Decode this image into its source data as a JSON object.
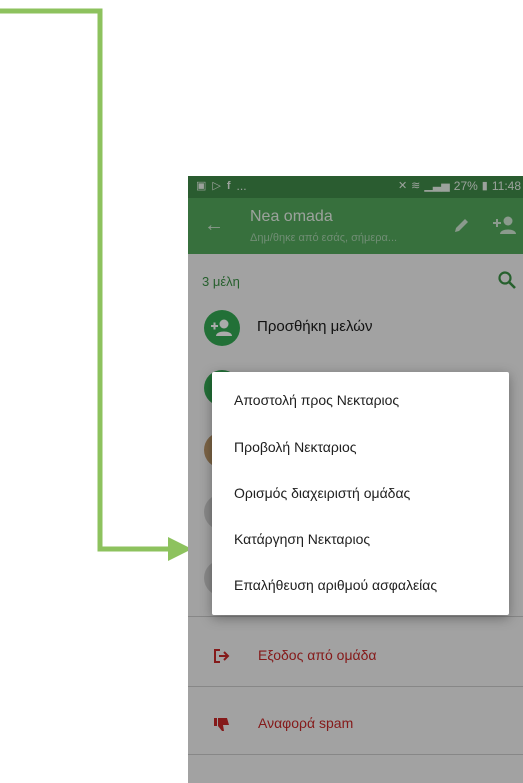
{
  "status_bar": {
    "left_icons": [
      "gallery-icon",
      "play-store-icon",
      "facebook-icon"
    ],
    "overflow": "...",
    "battery": "27%",
    "time": "11:48"
  },
  "app_bar": {
    "title": "Nea omada",
    "subtitle": "Δημ/θηκε από εσάς, σήμερα..."
  },
  "members": {
    "count_label": "3 μέλη",
    "add_label": "Προσθήκη μελών"
  },
  "context_menu": {
    "items": [
      "Αποστολή προς Νεκταριος",
      "Προβολή Νεκταριος",
      "Ορισμός διαχειριστή ομάδας",
      "Κατάργηση Νεκταριος",
      "Επαλήθευση αριθμού ασφαλείας"
    ]
  },
  "group_actions": {
    "exit_label": "Εξοδος από ομάδα",
    "report_label": "Αναφορά spam"
  },
  "colors": {
    "app_bar": "#52a75c",
    "status_bar": "#3f8a48",
    "accent": "#34a853",
    "danger": "#c62828",
    "annotation_arrow": "#8dc25e"
  }
}
